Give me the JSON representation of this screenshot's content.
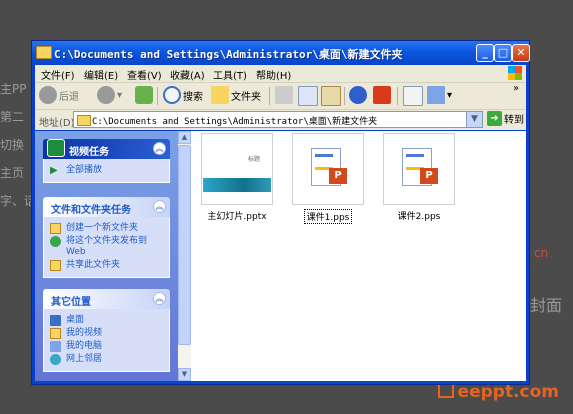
{
  "background": {
    "left_fragments": [
      "主PP",
      "第二",
      "切换",
      "主页",
      "字、话"
    ],
    "right_fragments": [
      "cn",
      "封面"
    ],
    "watermark": "eeppt.com"
  },
  "window": {
    "title": "C:\\Documents and Settings\\Administrator\\桌面\\新建文件夹",
    "controls": {
      "minimize": "_",
      "maximize": "□",
      "close": "✕"
    }
  },
  "menu": [
    "文件(F)",
    "编辑(E)",
    "查看(V)",
    "收藏(A)",
    "工具(T)",
    "帮助(H)"
  ],
  "toolbar": {
    "back": "后退",
    "forward_arrow": "▾",
    "search": "搜索",
    "folders": "文件夹",
    "chevron": "»"
  },
  "address": {
    "label": "地址(D)",
    "value": "C:\\Documents and Settings\\Administrator\\桌面\\新建文件夹",
    "go": "转到"
  },
  "tasks": {
    "video": {
      "title": "视频任务",
      "items": [
        "全部播放"
      ]
    },
    "file_folder": {
      "title": "文件和文件夹任务",
      "items": [
        "创建一个新文件夹",
        "将这个文件夹发布到 Web",
        "共享此文件夹"
      ]
    },
    "other_places": {
      "title": "其它位置",
      "items": [
        "桌面",
        "我的视频",
        "我的电脑",
        "网上邻居"
      ]
    }
  },
  "files": [
    {
      "name": "主幻灯片.pptx",
      "type": "pptx",
      "thumb_title": "标题",
      "selected": false
    },
    {
      "name": "课件1.pps",
      "type": "pps",
      "selected": true
    },
    {
      "name": "课件2.pps",
      "type": "pps",
      "selected": false
    }
  ],
  "colors": {
    "titlebar": "#0b56e0",
    "taskpane": "#6375d6",
    "accent_orange": "#e8641e"
  }
}
